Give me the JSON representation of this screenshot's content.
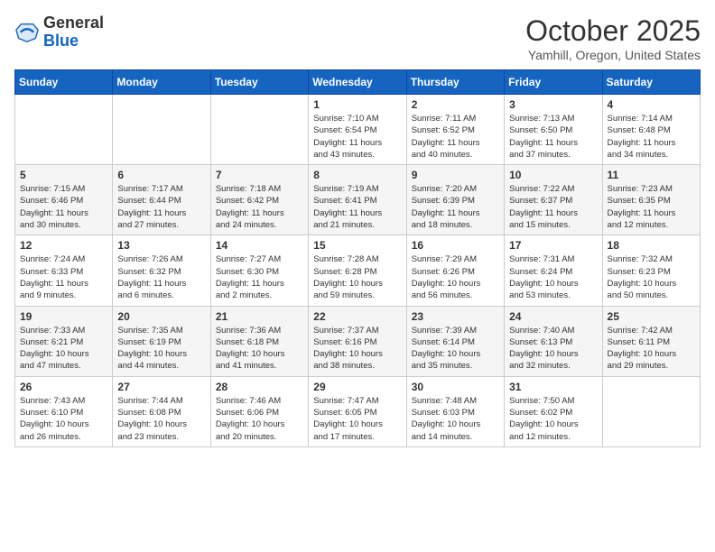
{
  "header": {
    "logo": {
      "line1": "General",
      "line2": "Blue"
    },
    "title": "October 2025",
    "subtitle": "Yamhill, Oregon, United States"
  },
  "weekdays": [
    "Sunday",
    "Monday",
    "Tuesday",
    "Wednesday",
    "Thursday",
    "Friday",
    "Saturday"
  ],
  "weeks": [
    [
      {
        "day": "",
        "info": ""
      },
      {
        "day": "",
        "info": ""
      },
      {
        "day": "",
        "info": ""
      },
      {
        "day": "1",
        "info": "Sunrise: 7:10 AM\nSunset: 6:54 PM\nDaylight: 11 hours\nand 43 minutes."
      },
      {
        "day": "2",
        "info": "Sunrise: 7:11 AM\nSunset: 6:52 PM\nDaylight: 11 hours\nand 40 minutes."
      },
      {
        "day": "3",
        "info": "Sunrise: 7:13 AM\nSunset: 6:50 PM\nDaylight: 11 hours\nand 37 minutes."
      },
      {
        "day": "4",
        "info": "Sunrise: 7:14 AM\nSunset: 6:48 PM\nDaylight: 11 hours\nand 34 minutes."
      }
    ],
    [
      {
        "day": "5",
        "info": "Sunrise: 7:15 AM\nSunset: 6:46 PM\nDaylight: 11 hours\nand 30 minutes."
      },
      {
        "day": "6",
        "info": "Sunrise: 7:17 AM\nSunset: 6:44 PM\nDaylight: 11 hours\nand 27 minutes."
      },
      {
        "day": "7",
        "info": "Sunrise: 7:18 AM\nSunset: 6:42 PM\nDaylight: 11 hours\nand 24 minutes."
      },
      {
        "day": "8",
        "info": "Sunrise: 7:19 AM\nSunset: 6:41 PM\nDaylight: 11 hours\nand 21 minutes."
      },
      {
        "day": "9",
        "info": "Sunrise: 7:20 AM\nSunset: 6:39 PM\nDaylight: 11 hours\nand 18 minutes."
      },
      {
        "day": "10",
        "info": "Sunrise: 7:22 AM\nSunset: 6:37 PM\nDaylight: 11 hours\nand 15 minutes."
      },
      {
        "day": "11",
        "info": "Sunrise: 7:23 AM\nSunset: 6:35 PM\nDaylight: 11 hours\nand 12 minutes."
      }
    ],
    [
      {
        "day": "12",
        "info": "Sunrise: 7:24 AM\nSunset: 6:33 PM\nDaylight: 11 hours\nand 9 minutes."
      },
      {
        "day": "13",
        "info": "Sunrise: 7:26 AM\nSunset: 6:32 PM\nDaylight: 11 hours\nand 6 minutes."
      },
      {
        "day": "14",
        "info": "Sunrise: 7:27 AM\nSunset: 6:30 PM\nDaylight: 11 hours\nand 2 minutes."
      },
      {
        "day": "15",
        "info": "Sunrise: 7:28 AM\nSunset: 6:28 PM\nDaylight: 10 hours\nand 59 minutes."
      },
      {
        "day": "16",
        "info": "Sunrise: 7:29 AM\nSunset: 6:26 PM\nDaylight: 10 hours\nand 56 minutes."
      },
      {
        "day": "17",
        "info": "Sunrise: 7:31 AM\nSunset: 6:24 PM\nDaylight: 10 hours\nand 53 minutes."
      },
      {
        "day": "18",
        "info": "Sunrise: 7:32 AM\nSunset: 6:23 PM\nDaylight: 10 hours\nand 50 minutes."
      }
    ],
    [
      {
        "day": "19",
        "info": "Sunrise: 7:33 AM\nSunset: 6:21 PM\nDaylight: 10 hours\nand 47 minutes."
      },
      {
        "day": "20",
        "info": "Sunrise: 7:35 AM\nSunset: 6:19 PM\nDaylight: 10 hours\nand 44 minutes."
      },
      {
        "day": "21",
        "info": "Sunrise: 7:36 AM\nSunset: 6:18 PM\nDaylight: 10 hours\nand 41 minutes."
      },
      {
        "day": "22",
        "info": "Sunrise: 7:37 AM\nSunset: 6:16 PM\nDaylight: 10 hours\nand 38 minutes."
      },
      {
        "day": "23",
        "info": "Sunrise: 7:39 AM\nSunset: 6:14 PM\nDaylight: 10 hours\nand 35 minutes."
      },
      {
        "day": "24",
        "info": "Sunrise: 7:40 AM\nSunset: 6:13 PM\nDaylight: 10 hours\nand 32 minutes."
      },
      {
        "day": "25",
        "info": "Sunrise: 7:42 AM\nSunset: 6:11 PM\nDaylight: 10 hours\nand 29 minutes."
      }
    ],
    [
      {
        "day": "26",
        "info": "Sunrise: 7:43 AM\nSunset: 6:10 PM\nDaylight: 10 hours\nand 26 minutes."
      },
      {
        "day": "27",
        "info": "Sunrise: 7:44 AM\nSunset: 6:08 PM\nDaylight: 10 hours\nand 23 minutes."
      },
      {
        "day": "28",
        "info": "Sunrise: 7:46 AM\nSunset: 6:06 PM\nDaylight: 10 hours\nand 20 minutes."
      },
      {
        "day": "29",
        "info": "Sunrise: 7:47 AM\nSunset: 6:05 PM\nDaylight: 10 hours\nand 17 minutes."
      },
      {
        "day": "30",
        "info": "Sunrise: 7:48 AM\nSunset: 6:03 PM\nDaylight: 10 hours\nand 14 minutes."
      },
      {
        "day": "31",
        "info": "Sunrise: 7:50 AM\nSunset: 6:02 PM\nDaylight: 10 hours\nand 12 minutes."
      },
      {
        "day": "",
        "info": ""
      }
    ]
  ]
}
